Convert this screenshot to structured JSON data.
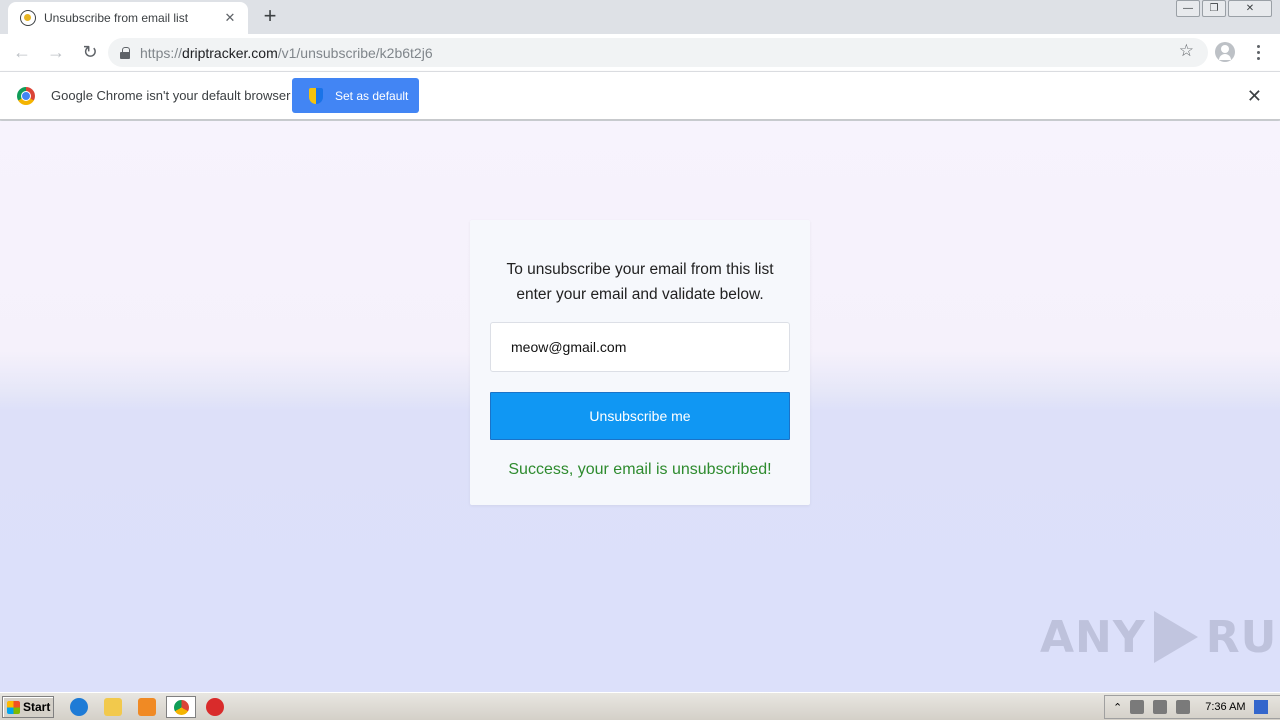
{
  "browser": {
    "tab": {
      "title": "Unsubscribe from email list",
      "close": "✕"
    },
    "new_tab": "+",
    "window_controls": {
      "minimize": "—",
      "restore": "❐",
      "close": "✕"
    },
    "nav": {
      "back": "←",
      "forward": "→",
      "reload": "↻"
    },
    "url": {
      "scheme": "https://",
      "host": "driptracker.com",
      "path": "/v1/unsubscribe/k2b6t2j6"
    },
    "bookmark_star": "☆"
  },
  "infobar": {
    "message": "Google Chrome isn't your default browser",
    "button_label": "Set as default",
    "close": "✕"
  },
  "card": {
    "instructions_line1": "To unsubscribe your email from this list",
    "instructions_line2": "enter your email and validate below.",
    "email_value": "meow@gmail.com",
    "button_label": "Unsubscribe me",
    "success_message": "Success, your email is unsubscribed!",
    "colors": {
      "button": "#1097f3",
      "success": "#2e8b2e"
    }
  },
  "watermark": {
    "left": "ANY",
    "right": "RUN"
  },
  "taskbar": {
    "start_label": "Start",
    "icons": [
      "internet-explorer-icon",
      "folder-icon",
      "media-player-icon",
      "chrome-icon",
      "avast-icon"
    ],
    "tray_expand": "⌃",
    "clock": "7:36 AM"
  }
}
